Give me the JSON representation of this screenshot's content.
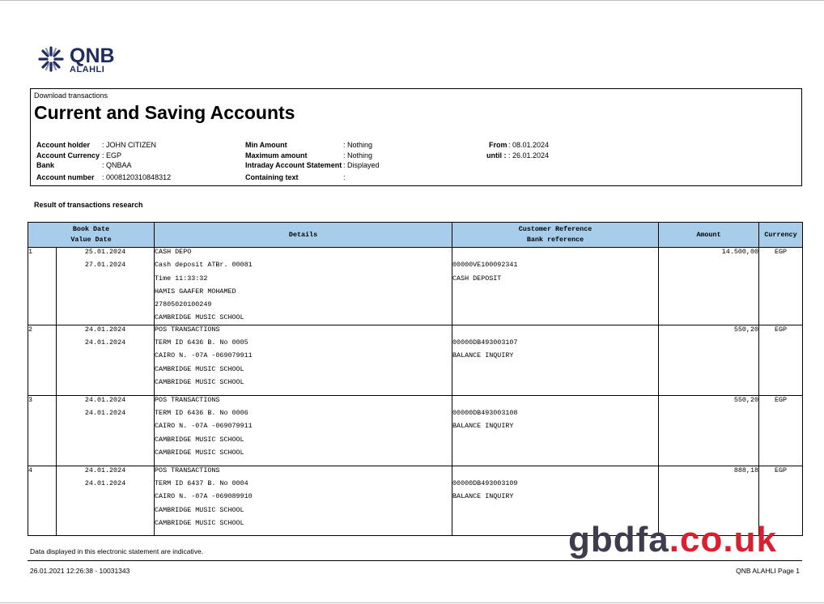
{
  "logo": {
    "name": "QNB",
    "sub": "ALAHLI"
  },
  "header": {
    "download_label": "Download transactions",
    "title": "Current and Saving Accounts"
  },
  "fields": {
    "account_holder": {
      "label": "Account holder",
      "value": ": JOHN CITIZEN"
    },
    "account_currency": {
      "label": "Account Currency",
      "value": ": EGP"
    },
    "bank": {
      "label": "Bank",
      "value": ": QNBAA"
    },
    "account_number": {
      "label": "Account number",
      "value": ": 0008120310848312"
    },
    "min_amount": {
      "label": "Min Amount",
      "value": ": Nothing"
    },
    "max_amount": {
      "label": "Maximum amount",
      "value": ": Nothing"
    },
    "intraday": {
      "label": "Intraday Account Statement",
      "value": ": Displayed"
    },
    "containing_text": {
      "label": "Containing text",
      "value": ":"
    },
    "from": {
      "label": "From",
      "value": ": 08.01.2024"
    },
    "until": {
      "label": "until :",
      "value": ": 26.01.2024"
    }
  },
  "result_label": "Result of transactions research",
  "table": {
    "headers": {
      "book_date": "Book Date",
      "value_date": "Value Date",
      "details": "Details",
      "customer_reference": "Customer Reference",
      "bank_reference": "Bank reference",
      "amount": "Amount",
      "currency": "Currency"
    },
    "rows": [
      {
        "index": "1",
        "book_date": "25.01.2024",
        "value_date": "27.01.2024",
        "details": [
          "CASH DEPO",
          "Cash deposit ATBr. 00081",
          "Time 11:33:32",
          "HAMIS GAAFER MOHAMED",
          "27805020100249",
          "CAMBRIDGE MUSIC SCHOOL"
        ],
        "ref": [
          "00000VE100092341",
          "CASH DEPOSIT"
        ],
        "amount": "14.500,00",
        "currency": "EGP"
      },
      {
        "index": "2",
        "book_date": "24.01.2024",
        "value_date": "24.01.2024",
        "details": [
          "POS TRANSACTIONS",
          "TERM ID 6436 B. No 0005",
          "CAIRO N. -07A  -069079911",
          "CAMBRIDGE MUSIC SCHOOL",
          "CAMBRIDGE MUSIC SCHOOL"
        ],
        "ref": [
          "00000DB493003107",
          "BALANCE INQUIRY"
        ],
        "amount": "550,20",
        "currency": "EGP"
      },
      {
        "index": "3",
        "book_date": "24.01.2024",
        "value_date": "24.01.2024",
        "details": [
          "POS TRANSACTIONS",
          "TERM ID 6436 B. No 0006",
          "CAIRO N. -07A  -069079911",
          "CAMBRIDGE MUSIC SCHOOL",
          "CAMBRIDGE MUSIC SCHOOL"
        ],
        "ref": [
          "00000DB493003108",
          "BALANCE INQUIRY"
        ],
        "amount": "550,20",
        "currency": "EGP"
      },
      {
        "index": "4",
        "book_date": "24.01.2024",
        "value_date": "24.01.2024",
        "details": [
          "POS TRANSACTIONS",
          "TERM ID 6437 B. No 0004",
          "CAIRO N. -07A  -069089910",
          "CAMBRIDGE MUSIC SCHOOL",
          "CAMBRIDGE MUSIC SCHOOL"
        ],
        "ref": [
          "00000DB493003109",
          "BALANCE INQUIRY"
        ],
        "amount": "888,18",
        "currency": "EGP"
      }
    ]
  },
  "footer": {
    "note": "Data displayed in this electronic statement are indicative.",
    "timestamp": "26.01.2021 12:26:38 - 10031343",
    "page": "QNB ALAHLI Page 1"
  },
  "watermark": {
    "part1": "gbdfa",
    "part2": ".co.uk"
  },
  "colors": {
    "header_fill": "#a7cdea",
    "brand_navy": "#1f2b5c",
    "watermark_red": "#d92030"
  }
}
